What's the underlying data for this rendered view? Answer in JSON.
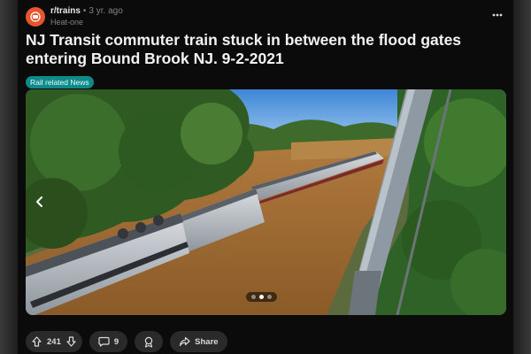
{
  "post": {
    "subreddit": "r/trains",
    "separator": "•",
    "time_ago": "3 yr. ago",
    "username": "Heat-one",
    "title": "NJ Transit commuter train stuck in between the flood gates entering Bound Brook NJ. 9-2-2021",
    "flair": "Rail related News",
    "more_icon": "ellipsis-icon",
    "avatar_icon": "subreddit-avatar-icon"
  },
  "media": {
    "carousel_pages": 3,
    "active_page": 2,
    "prev_icon": "chevron-left-icon"
  },
  "actions": {
    "upvote_icon": "arrow-up-icon",
    "score": "241",
    "downvote_icon": "arrow-down-icon",
    "comments_count": "9",
    "comment_icon": "comment-bubble-icon",
    "award_icon": "award-icon",
    "share_label": "Share",
    "share_icon": "share-icon"
  },
  "colors": {
    "background": "#0b0b0b",
    "flair": "#0e8a8a",
    "avatar": "#e8542c",
    "pill": "#2a2a2a"
  }
}
